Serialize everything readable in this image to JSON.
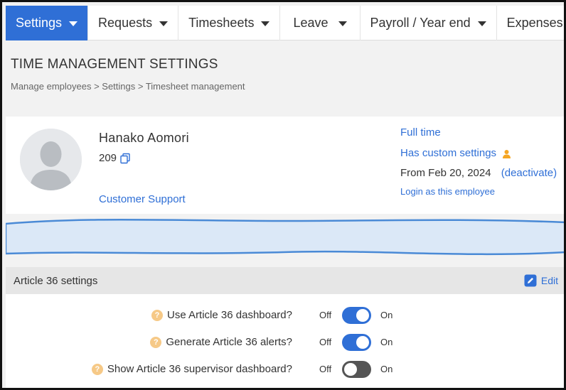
{
  "nav": {
    "items": [
      {
        "label": "Settings",
        "active": true
      },
      {
        "label": "Requests"
      },
      {
        "label": "Timesheets"
      },
      {
        "label": "Leave"
      },
      {
        "label": "Payroll / Year end"
      },
      {
        "label": "Expenses"
      }
    ]
  },
  "header": {
    "title": "TIME MANAGEMENT SETTINGS",
    "breadcrumb": "Manage employees > Settings > Timesheet management"
  },
  "employee": {
    "name": "Hanako Aomori",
    "id": "209",
    "group": "Customer Support",
    "employment_type": "Full time",
    "custom_settings": "Has custom settings",
    "from_date": "From Feb 20, 2024",
    "deactivate": "(deactivate)",
    "login_as": "Login as this employee"
  },
  "section": {
    "title": "Article 36 settings",
    "edit_label": "Edit"
  },
  "settings": [
    {
      "label": "Use Article 36 dashboard?",
      "off": "Off",
      "on": "On",
      "state": "on"
    },
    {
      "label": "Generate Article 36 alerts?",
      "off": "Off",
      "on": "On",
      "state": "on"
    },
    {
      "label": "Show Article 36 supervisor dashboard?",
      "off": "Off",
      "on": "On",
      "state": "off"
    }
  ],
  "colors": {
    "accent": "#2f6fd6",
    "toggle_off": "#555555",
    "help_icon": "#f6c987",
    "custom_user_icon": "#f5a623"
  }
}
